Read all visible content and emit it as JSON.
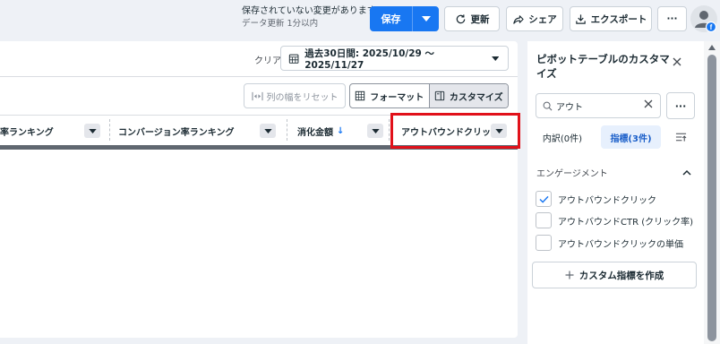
{
  "header": {
    "unsaved_line1": "保存されていない変更があります",
    "unsaved_line2": "データ更新 1分以内",
    "save_label": "保存",
    "refresh_label": "更新",
    "share_label": "シェア",
    "export_label": "エクスポート",
    "more_label": "···",
    "accent_color": "#1877f2"
  },
  "toolbar": {
    "clear_label": "クリア",
    "date_range": "過去30日間: 2025/10/29 ～ 2025/11/27",
    "reset_width_label": "列の幅をリセット",
    "format_label": "フォーマット",
    "customize_label": "カスタマイズ"
  },
  "table": {
    "columns": [
      {
        "label": "率ランキング"
      },
      {
        "label": "コンバージョン率ランキング"
      },
      {
        "label": "消化金額",
        "sort_indicator": "↓"
      },
      {
        "label": "アウトバウンドクリック"
      }
    ]
  },
  "panel": {
    "title": "ピボットテーブルのカスタマイズ",
    "search_value": "アウト",
    "tabs": [
      {
        "label": "内訳(0件)",
        "active": false
      },
      {
        "label": "指標(3件)",
        "active": true
      }
    ],
    "section_title": "エンゲージメント",
    "items": [
      {
        "label": "アウトバウンドクリック",
        "checked": true
      },
      {
        "label": "アウトバウンドCTR (クリック率)",
        "checked": false
      },
      {
        "label": "アウトバウンドクリックの単価",
        "checked": false
      }
    ],
    "create_label": "カスタム指標を作成"
  },
  "icons": {
    "refresh": "refresh-icon",
    "share": "share-icon",
    "export": "export-icon",
    "calendar": "calendar-icon",
    "search": "search-icon",
    "close": "close-icon"
  }
}
